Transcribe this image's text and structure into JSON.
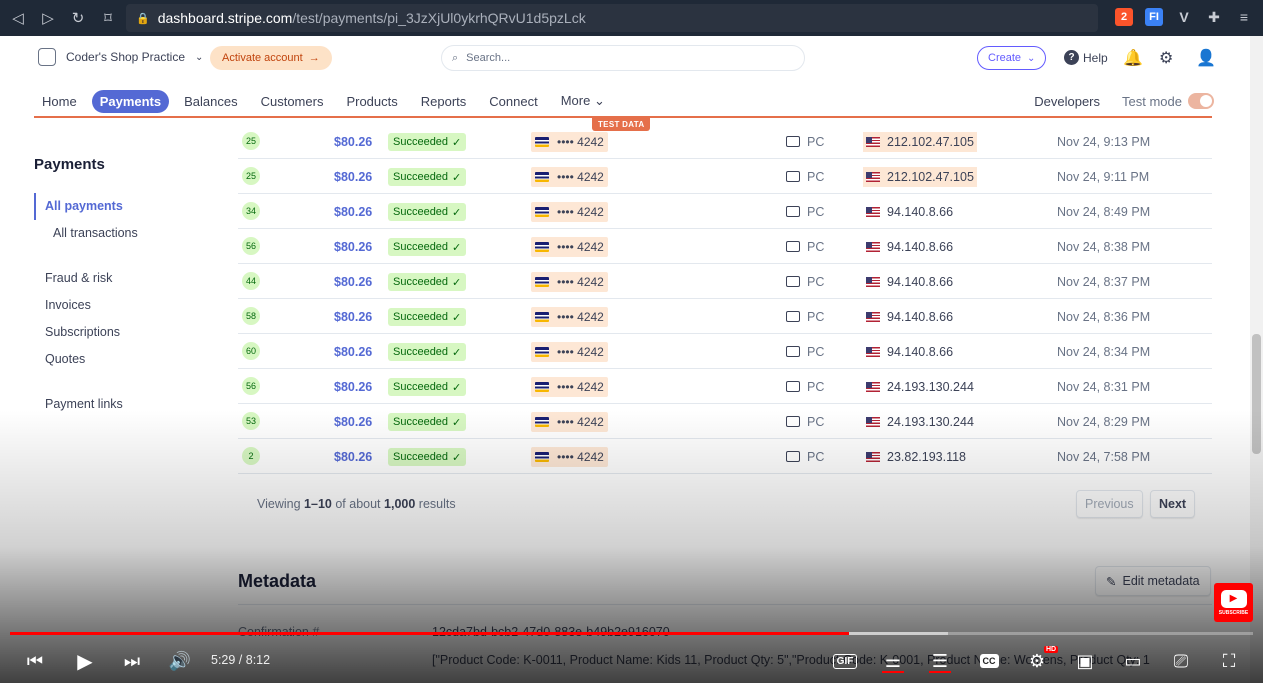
{
  "browser": {
    "url_domain": "dashboard.stripe.com",
    "url_path": "/test/payments/pi_3JzXjUl0ykrhQRvU1d5pzLck",
    "brave_badge": "2",
    "ext_label": "FI"
  },
  "topbar": {
    "shop_name": "Coder's Shop Practice",
    "activate_label": "Activate account",
    "search_placeholder": "Search...",
    "create_label": "Create",
    "help_label": "Help"
  },
  "nav": {
    "items": [
      "Home",
      "Payments",
      "Balances",
      "Customers",
      "Products",
      "Reports",
      "Connect",
      "More"
    ],
    "developers": "Developers",
    "test_mode": "Test mode",
    "test_badge": "TEST DATA"
  },
  "sidebar": {
    "title": "Payments",
    "items": [
      "All payments",
      "All transactions",
      "Fraud & risk",
      "Invoices",
      "Subscriptions",
      "Quotes",
      "Payment links"
    ]
  },
  "payments": [
    {
      "risk": "25",
      "amount": "$80.26",
      "status": "Succeeded",
      "card": "•••• 4242",
      "device": "PC",
      "ip": "212.102.47.105",
      "ip_highlight": true,
      "date": "Nov 24, 9:13 PM"
    },
    {
      "risk": "25",
      "amount": "$80.26",
      "status": "Succeeded",
      "card": "•••• 4242",
      "device": "PC",
      "ip": "212.102.47.105",
      "ip_highlight": true,
      "date": "Nov 24, 9:11 PM"
    },
    {
      "risk": "34",
      "amount": "$80.26",
      "status": "Succeeded",
      "card": "•••• 4242",
      "device": "PC",
      "ip": "94.140.8.66",
      "ip_highlight": false,
      "date": "Nov 24, 8:49 PM"
    },
    {
      "risk": "56",
      "amount": "$80.26",
      "status": "Succeeded",
      "card": "•••• 4242",
      "device": "PC",
      "ip": "94.140.8.66",
      "ip_highlight": false,
      "date": "Nov 24, 8:38 PM"
    },
    {
      "risk": "44",
      "amount": "$80.26",
      "status": "Succeeded",
      "card": "•••• 4242",
      "device": "PC",
      "ip": "94.140.8.66",
      "ip_highlight": false,
      "date": "Nov 24, 8:37 PM"
    },
    {
      "risk": "58",
      "amount": "$80.26",
      "status": "Succeeded",
      "card": "•••• 4242",
      "device": "PC",
      "ip": "94.140.8.66",
      "ip_highlight": false,
      "date": "Nov 24, 8:36 PM"
    },
    {
      "risk": "60",
      "amount": "$80.26",
      "status": "Succeeded",
      "card": "•••• 4242",
      "device": "PC",
      "ip": "94.140.8.66",
      "ip_highlight": false,
      "date": "Nov 24, 8:34 PM"
    },
    {
      "risk": "56",
      "amount": "$80.26",
      "status": "Succeeded",
      "card": "•••• 4242",
      "device": "PC",
      "ip": "24.193.130.244",
      "ip_highlight": false,
      "date": "Nov 24, 8:31 PM"
    },
    {
      "risk": "53",
      "amount": "$80.26",
      "status": "Succeeded",
      "card": "•••• 4242",
      "device": "PC",
      "ip": "24.193.130.244",
      "ip_highlight": false,
      "date": "Nov 24, 8:29 PM"
    },
    {
      "risk": "2",
      "amount": "$80.26",
      "status": "Succeeded",
      "card": "•••• 4242",
      "device": "PC",
      "ip": "23.82.193.118",
      "ip_highlight": false,
      "date": "Nov 24, 7:58 PM"
    }
  ],
  "pager": {
    "viewing_prefix": "Viewing",
    "range": "1–10",
    "of_about": "of about",
    "total": "1,000",
    "results": "results",
    "previous": "Previous",
    "next": "Next"
  },
  "metadata": {
    "title": "Metadata",
    "edit_label": "Edit metadata",
    "rows": [
      {
        "key": "Confirmation #",
        "value": "12cda7bd-bcb2-47d0-883e-b49b2e916070"
      },
      {
        "key": "",
        "value": "[\"Product Code: K-0011, Product Name: Kids 11, Product Qty: 5\",\"Product Code: K-0001, Product Name: Womens, Product Qty: 1"
      }
    ]
  },
  "player": {
    "time": "5:29 / 8:12",
    "progress": 0.675,
    "buffered": 0.755,
    "gif_label": "GIF",
    "cc_label": "CC",
    "hd_label": "HD",
    "subscribe_label": "SUBSCRIBE"
  }
}
